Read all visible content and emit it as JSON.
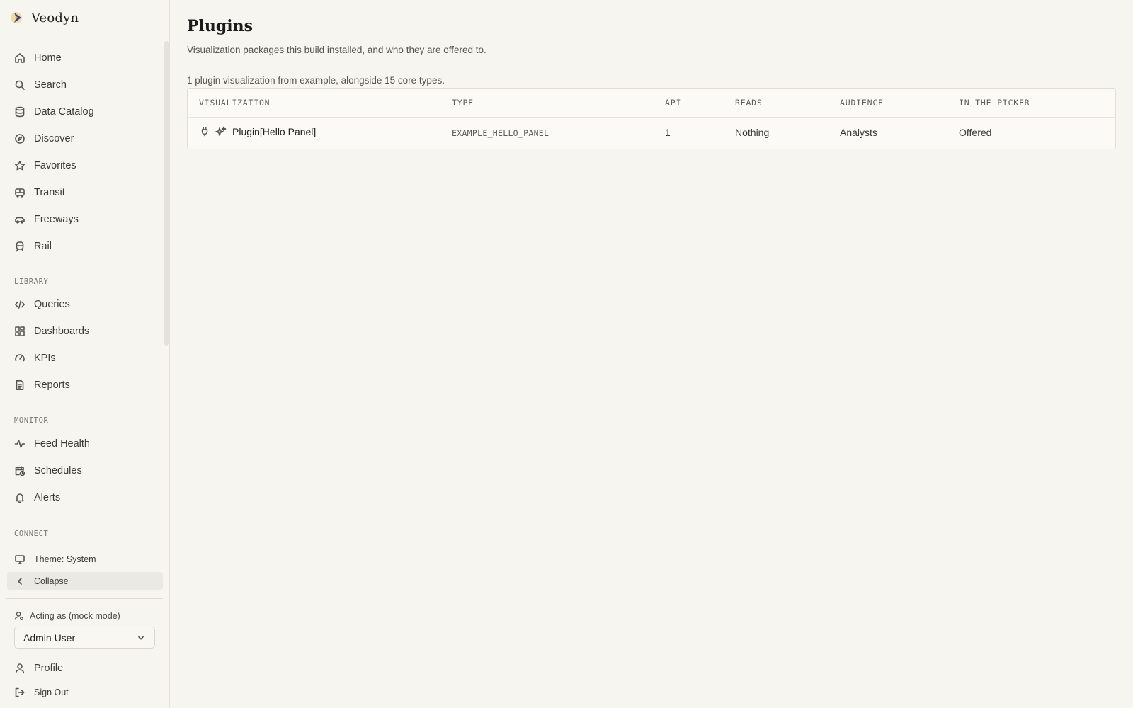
{
  "brand": {
    "name": "Veodyn",
    "logo_colors": [
      "#e6b422",
      "#3d3d8a",
      "#2a2a28"
    ]
  },
  "sidebar": {
    "primary": [
      {
        "label": "Home",
        "icon": "home-icon"
      },
      {
        "label": "Search",
        "icon": "search-icon"
      },
      {
        "label": "Data Catalog",
        "icon": "database-icon"
      },
      {
        "label": "Discover",
        "icon": "compass-icon"
      },
      {
        "label": "Favorites",
        "icon": "star-icon"
      },
      {
        "label": "Transit",
        "icon": "bus-icon"
      },
      {
        "label": "Freeways",
        "icon": "car-icon"
      },
      {
        "label": "Rail",
        "icon": "train-icon"
      }
    ],
    "library_label": "LIBRARY",
    "library": [
      {
        "label": "Queries",
        "icon": "code-icon"
      },
      {
        "label": "Dashboards",
        "icon": "grid-icon"
      },
      {
        "label": "KPIs",
        "icon": "gauge-icon"
      },
      {
        "label": "Reports",
        "icon": "document-icon"
      }
    ],
    "monitor_label": "MONITOR",
    "monitor": [
      {
        "label": "Feed Health",
        "icon": "activity-icon"
      },
      {
        "label": "Schedules",
        "icon": "calendar-clock-icon"
      },
      {
        "label": "Alerts",
        "icon": "bell-icon"
      }
    ],
    "connect_label": "CONNECT",
    "theme_label": "Theme: System",
    "collapse_label": "Collapse",
    "acting_label": "Acting as (mock mode)",
    "acting_value": "Admin User",
    "profile_label": "Profile",
    "signout_label": "Sign Out"
  },
  "main": {
    "title": "Plugins",
    "subtitle": "Visualization packages this build installed, and who they are offered to.",
    "summary": "1 plugin visualization from example, alongside 15 core types.",
    "columns": [
      "VISUALIZATION",
      "TYPE",
      "API",
      "READS",
      "AUDIENCE",
      "IN THE PICKER"
    ],
    "rows": [
      {
        "visualization": "Plugin[Hello Panel]",
        "type": "EXAMPLE_HELLO_PANEL",
        "api": "1",
        "reads": "Nothing",
        "audience": "Analysts",
        "picker": "Offered"
      }
    ]
  }
}
